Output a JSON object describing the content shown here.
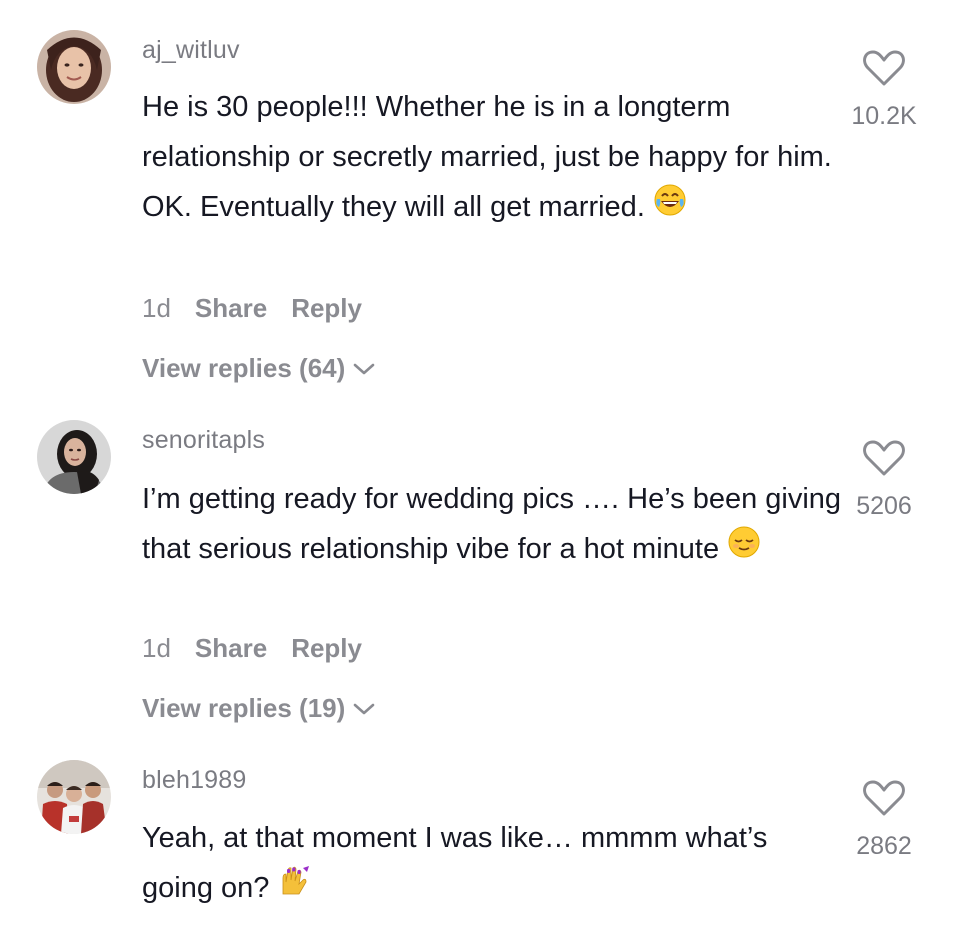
{
  "comments": [
    {
      "username": "aj_witluv",
      "text": "He is 30 people!!! Whether he is in a longterm relationship or secretly married, just be happy for him. OK. Eventually they will all get married.",
      "emoji": "tears-of-joy-emoji",
      "time": "1d",
      "share_label": "Share",
      "reply_label": "Reply",
      "view_replies": "View replies (64)",
      "likes": "10.2K",
      "avatar_icon": "user-avatar-woman"
    },
    {
      "username": "senoritapls",
      "text": "I’m getting ready for wedding pics …. He’s been giving that serious relationship vibe for a hot minute",
      "emoji": "relieved-face-emoji",
      "time": "1d",
      "share_label": "Share",
      "reply_label": "Reply",
      "view_replies": "View replies (19)",
      "likes": "5206",
      "avatar_icon": "user-avatar-woman-dark-hair"
    },
    {
      "username": "bleh1989",
      "text": "Yeah, at that moment I was like… mmmm what’s going on?",
      "emoji": "nail-polish-emoji",
      "likes": "2862",
      "avatar_icon": "user-avatar-group"
    }
  ],
  "icons": {
    "like": "heart-outline-icon",
    "expand": "chevron-down-icon"
  },
  "colors": {
    "text": "#161823",
    "muted": "#8a8b91",
    "username": "#7a7b82",
    "background": "#ffffff"
  }
}
